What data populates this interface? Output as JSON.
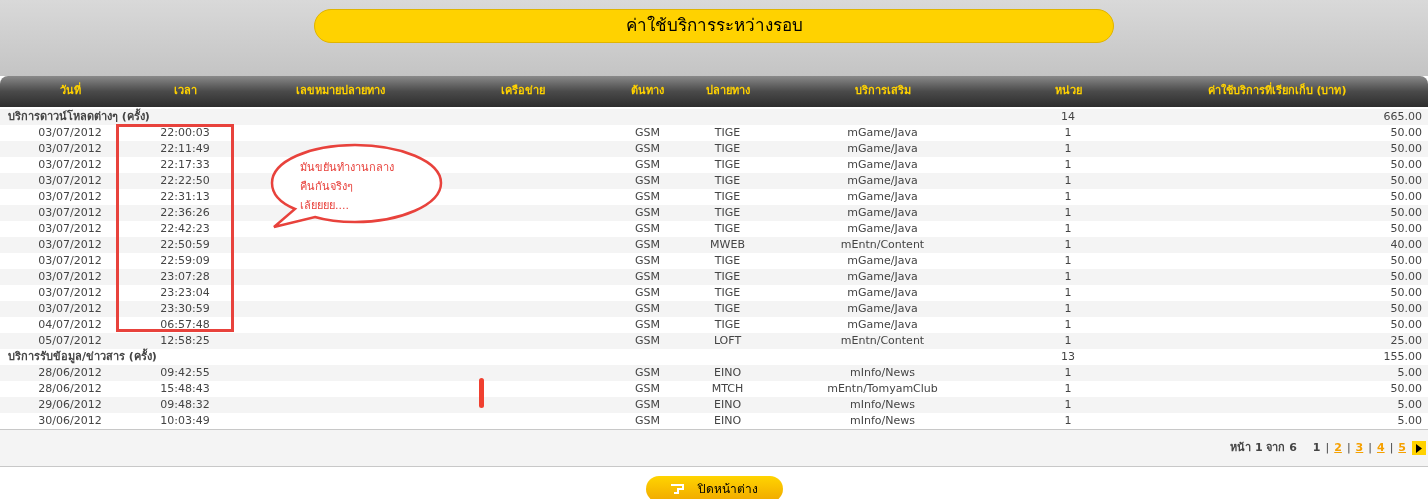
{
  "title": "ค่าใช้บริการระหว่างรอบ",
  "table": {
    "columns": [
      "วันที่",
      "เวลา",
      "เลขหมายปลายทาง",
      "เครือข่าย",
      "ต้นทาง",
      "ปลายทาง",
      "บริการเสริม",
      "หน่วย",
      "ค่าใช้บริการที่เรียกเก็บ (บาท)"
    ],
    "groups": [
      {
        "label": "บริการดาวน์โหลดต่างๆ (ครั้ง)",
        "units": "14",
        "total": "665.00",
        "rows": [
          {
            "date": "03/07/2012",
            "time": "22:00:03",
            "origin": "GSM",
            "dest": "TIGE",
            "service": "mGame/Java",
            "units": "1",
            "fee": "50.00"
          },
          {
            "date": "03/07/2012",
            "time": "22:11:49",
            "origin": "GSM",
            "dest": "TIGE",
            "service": "mGame/Java",
            "units": "1",
            "fee": "50.00"
          },
          {
            "date": "03/07/2012",
            "time": "22:17:33",
            "origin": "GSM",
            "dest": "TIGE",
            "service": "mGame/Java",
            "units": "1",
            "fee": "50.00"
          },
          {
            "date": "03/07/2012",
            "time": "22:22:50",
            "origin": "GSM",
            "dest": "TIGE",
            "service": "mGame/Java",
            "units": "1",
            "fee": "50.00"
          },
          {
            "date": "03/07/2012",
            "time": "22:31:13",
            "origin": "GSM",
            "dest": "TIGE",
            "service": "mGame/Java",
            "units": "1",
            "fee": "50.00"
          },
          {
            "date": "03/07/2012",
            "time": "22:36:26",
            "origin": "GSM",
            "dest": "TIGE",
            "service": "mGame/Java",
            "units": "1",
            "fee": "50.00"
          },
          {
            "date": "03/07/2012",
            "time": "22:42:23",
            "origin": "GSM",
            "dest": "TIGE",
            "service": "mGame/Java",
            "units": "1",
            "fee": "50.00"
          },
          {
            "date": "03/07/2012",
            "time": "22:50:59",
            "origin": "GSM",
            "dest": "MWEB",
            "service": "mEntn/Content",
            "units": "1",
            "fee": "40.00"
          },
          {
            "date": "03/07/2012",
            "time": "22:59:09",
            "origin": "GSM",
            "dest": "TIGE",
            "service": "mGame/Java",
            "units": "1",
            "fee": "50.00"
          },
          {
            "date": "03/07/2012",
            "time": "23:07:28",
            "origin": "GSM",
            "dest": "TIGE",
            "service": "mGame/Java",
            "units": "1",
            "fee": "50.00"
          },
          {
            "date": "03/07/2012",
            "time": "23:23:04",
            "origin": "GSM",
            "dest": "TIGE",
            "service": "mGame/Java",
            "units": "1",
            "fee": "50.00"
          },
          {
            "date": "03/07/2012",
            "time": "23:30:59",
            "origin": "GSM",
            "dest": "TIGE",
            "service": "mGame/Java",
            "units": "1",
            "fee": "50.00"
          },
          {
            "date": "04/07/2012",
            "time": "06:57:48",
            "origin": "GSM",
            "dest": "TIGE",
            "service": "mGame/Java",
            "units": "1",
            "fee": "50.00"
          },
          {
            "date": "05/07/2012",
            "time": "12:58:25",
            "origin": "GSM",
            "dest": "LOFT",
            "service": "mEntn/Content",
            "units": "1",
            "fee": "25.00"
          }
        ]
      },
      {
        "label": "บริการรับข้อมูล/ข่าวสาร (ครั้ง)",
        "units": "13",
        "total": "155.00",
        "rows": [
          {
            "date": "28/06/2012",
            "time": "09:42:55",
            "origin": "GSM",
            "dest": "EINO",
            "service": "mInfo/News",
            "units": "1",
            "fee": "5.00"
          },
          {
            "date": "28/06/2012",
            "time": "15:48:43",
            "origin": "GSM",
            "dest": "MTCH",
            "service": "mEntn/TomyamClub",
            "units": "1",
            "fee": "50.00"
          },
          {
            "date": "29/06/2012",
            "time": "09:48:32",
            "origin": "GSM",
            "dest": "EINO",
            "service": "mInfo/News",
            "units": "1",
            "fee": "5.00"
          },
          {
            "date": "30/06/2012",
            "time": "10:03:49",
            "origin": "GSM",
            "dest": "EINO",
            "service": "mInfo/News",
            "units": "1",
            "fee": "5.00"
          }
        ]
      }
    ]
  },
  "pagination": {
    "summary": "หน้า 1 จาก 6",
    "separator": "|",
    "pages": [
      {
        "label": "1",
        "selected": true
      },
      {
        "label": "2",
        "selected": false
      },
      {
        "label": "3",
        "selected": false
      },
      {
        "label": "4",
        "selected": false
      },
      {
        "label": "5",
        "selected": false
      }
    ]
  },
  "close_button": "ปิดหน้าต่าง",
  "callout": {
    "lines": [
      "มันขยันทำงานกลาง",
      "คืนกันจริงๆ",
      "เล้ยยยย...."
    ]
  }
}
